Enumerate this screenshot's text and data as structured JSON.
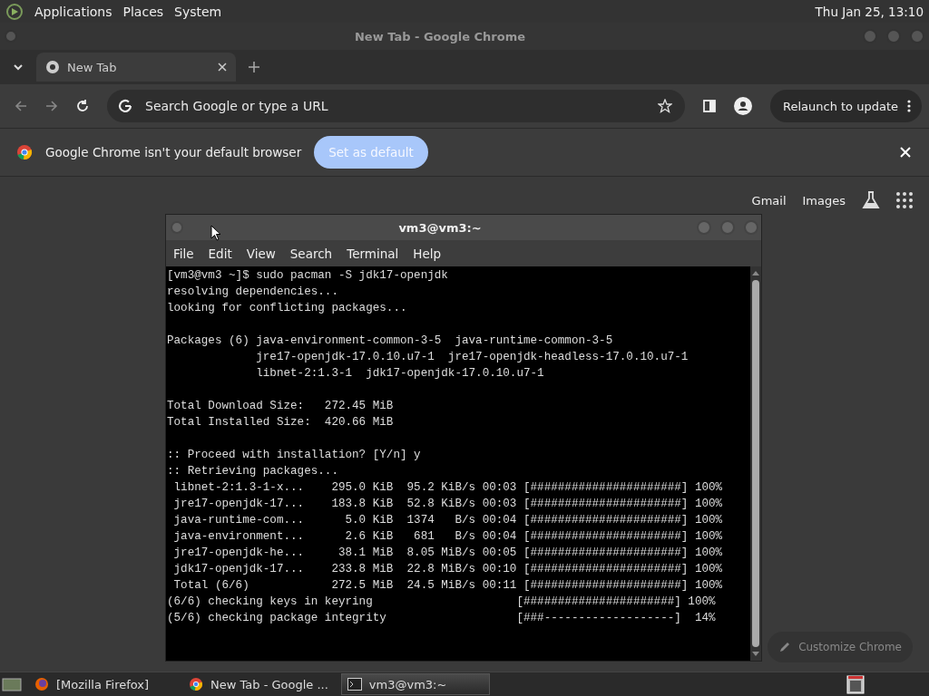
{
  "top_panel": {
    "menus": [
      "Applications",
      "Places",
      "System"
    ],
    "clock": "Thu Jan 25, 13:10"
  },
  "browser": {
    "title": "New Tab - Google Chrome",
    "tabs": [
      {
        "label": "New Tab",
        "selected": true
      }
    ],
    "omnibox": {
      "placeholder": "Search Google or type a URL"
    },
    "relaunch": "Relaunch to update",
    "infobar": {
      "message": "Google Chrome isn't your default browser",
      "button": "Set as default"
    },
    "links": [
      "Gmail",
      "Images"
    ],
    "customize": "Customize Chrome"
  },
  "terminal": {
    "title": "vm3@vm3:~",
    "menus": [
      "File",
      "Edit",
      "View",
      "Search",
      "Terminal",
      "Help"
    ],
    "blocks": [
      [
        "[vm3@vm3 ~]$ sudo pacman -S jdk17-openjdk",
        "resolving dependencies...",
        "looking for conflicting packages..."
      ],
      [
        "Packages (6) java-environment-common-3-5  java-runtime-common-3-5",
        "             jre17-openjdk-17.0.10.u7-1  jre17-openjdk-headless-17.0.10.u7-1",
        "             libnet-2:1.3-1  jdk17-openjdk-17.0.10.u7-1"
      ],
      [
        "Total Download Size:   272.45 MiB",
        "Total Installed Size:  420.66 MiB"
      ],
      [
        ":: Proceed with installation? [Y/n] y",
        ":: Retrieving packages...",
        " libnet-2:1.3-1-x...    295.0 KiB  95.2 KiB/s 00:03 [######################] 100%",
        " jre17-openjdk-17...    183.8 KiB  52.8 KiB/s 00:03 [######################] 100%",
        " java-runtime-com...      5.0 KiB  1374   B/s 00:04 [######################] 100%",
        " java-environment...      2.6 KiB   681   B/s 00:04 [######################] 100%",
        " jre17-openjdk-he...     38.1 MiB  8.05 MiB/s 00:05 [######################] 100%",
        " jdk17-openjdk-17...    233.8 MiB  22.8 MiB/s 00:10 [######################] 100%",
        " Total (6/6)            272.5 MiB  24.5 MiB/s 00:11 [######################] 100%",
        "(6/6) checking keys in keyring                     [######################] 100%",
        "(5/6) checking package integrity                   [###-------------------]  14%"
      ]
    ]
  },
  "taskbar": [
    {
      "label": "[Mozilla Firefox]",
      "kind": "firefox",
      "selected": false
    },
    {
      "label": "New Tab - Google ...",
      "kind": "chrome",
      "selected": false
    },
    {
      "label": "vm3@vm3:~",
      "kind": "terminal",
      "selected": true
    }
  ]
}
